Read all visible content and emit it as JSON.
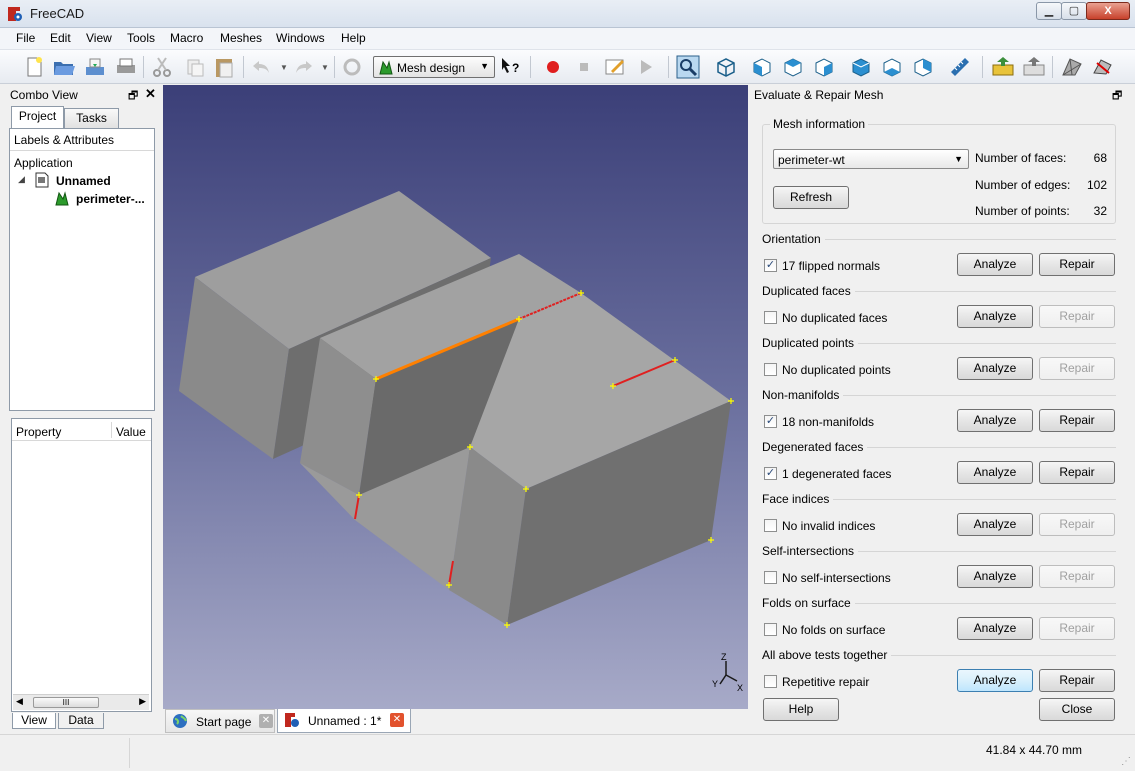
{
  "window": {
    "title": "FreeCAD",
    "min_label": "▁",
    "max_label": "▢",
    "close_label": "X"
  },
  "menu": {
    "items": [
      {
        "label": "File"
      },
      {
        "label": "Edit"
      },
      {
        "label": "View"
      },
      {
        "label": "Tools"
      },
      {
        "label": "Macro"
      },
      {
        "label": "Meshes"
      },
      {
        "label": "Windows"
      },
      {
        "label": "Help"
      }
    ]
  },
  "toolbar": {
    "workbench": "Mesh design",
    "icons": [
      "new-icon",
      "open-icon",
      "save-icon",
      "print-icon",
      "cut-icon",
      "copy-icon",
      "paste-icon",
      "undo-icon",
      "redo-icon",
      "refresh-icon",
      "whats-this-icon",
      "record-macro-icon",
      "stop-macro-icon",
      "edit-macro-icon",
      "run-macro-icon",
      "fit-all-icon",
      "axonometric-icon",
      "front-view-icon",
      "top-view-icon",
      "right-view-icon",
      "rear-view-icon",
      "bottom-view-icon",
      "left-view-icon",
      "measure-icon",
      "import-mesh-icon",
      "export-mesh-icon",
      "mesh-from-shape-icon",
      "evaluate-mesh-icon"
    ]
  },
  "combo_view": {
    "title": "Combo View",
    "float_label": "🗗",
    "close_label": "✕",
    "tabs": [
      {
        "label": "Project"
      },
      {
        "label": "Tasks"
      }
    ],
    "tree_header": "Labels & Attributes",
    "tree": {
      "root": "Application",
      "document": "Unnamed",
      "object": "perimeter-..."
    },
    "property_header": {
      "property": "Property",
      "value": "Value"
    },
    "scroll_thumb": "III",
    "bottom_tabs": [
      {
        "label": "View"
      },
      {
        "label": "Data"
      }
    ]
  },
  "doc_tabs": [
    {
      "label": "Start page"
    },
    {
      "label": "Unnamed : 1*"
    }
  ],
  "axis": {
    "x": "X",
    "y": "Y",
    "z": "Z"
  },
  "evaluate_panel": {
    "title": "Evaluate & Repair Mesh",
    "float_label": "🗗",
    "mesh_info": {
      "title": "Mesh information",
      "selected_mesh": "perimeter-wt",
      "refresh_label": "Refresh",
      "faces_label": "Number of faces:",
      "faces_value": "68",
      "edges_label": "Number of edges:",
      "edges_value": "102",
      "points_label": "Number of points:",
      "points_value": "32"
    },
    "sections": [
      {
        "title": "Orientation",
        "check_label": "17 flipped normals",
        "checked": true,
        "analyze": "Analyze",
        "repair": "Repair",
        "repair_enabled": true
      },
      {
        "title": "Duplicated faces",
        "check_label": "No duplicated faces",
        "checked": false,
        "analyze": "Analyze",
        "repair": "Repair",
        "repair_enabled": false
      },
      {
        "title": "Duplicated points",
        "check_label": "No duplicated points",
        "checked": false,
        "analyze": "Analyze",
        "repair": "Repair",
        "repair_enabled": false
      },
      {
        "title": "Non-manifolds",
        "check_label": "18 non-manifolds",
        "checked": true,
        "analyze": "Analyze",
        "repair": "Repair",
        "repair_enabled": true
      },
      {
        "title": "Degenerated faces",
        "check_label": "1 degenerated faces",
        "checked": true,
        "analyze": "Analyze",
        "repair": "Repair",
        "repair_enabled": true
      },
      {
        "title": "Face indices",
        "check_label": "No invalid indices",
        "checked": false,
        "analyze": "Analyze",
        "repair": "Repair",
        "repair_enabled": false
      },
      {
        "title": "Self-intersections",
        "check_label": "No self-intersections",
        "checked": false,
        "analyze": "Analyze",
        "repair": "Repair",
        "repair_enabled": false
      },
      {
        "title": "Folds on surface",
        "check_label": "No folds on surface",
        "checked": false,
        "analyze": "Analyze",
        "repair": "Repair",
        "repair_enabled": false
      },
      {
        "title": "All above tests together",
        "check_label": "Repetitive repair",
        "checked": false,
        "analyze": "Analyze",
        "repair": "Repair",
        "repair_enabled": true
      }
    ],
    "help_label": "Help",
    "close_label": "Close"
  },
  "statusbar": {
    "dimensions": "41.84 x 44.70 mm"
  },
  "colors": {
    "selection_edge": "#ff8000",
    "defect_edge": "#e02020",
    "mesh_face": "#8c8c8c",
    "point_marker": "#ffff00"
  }
}
